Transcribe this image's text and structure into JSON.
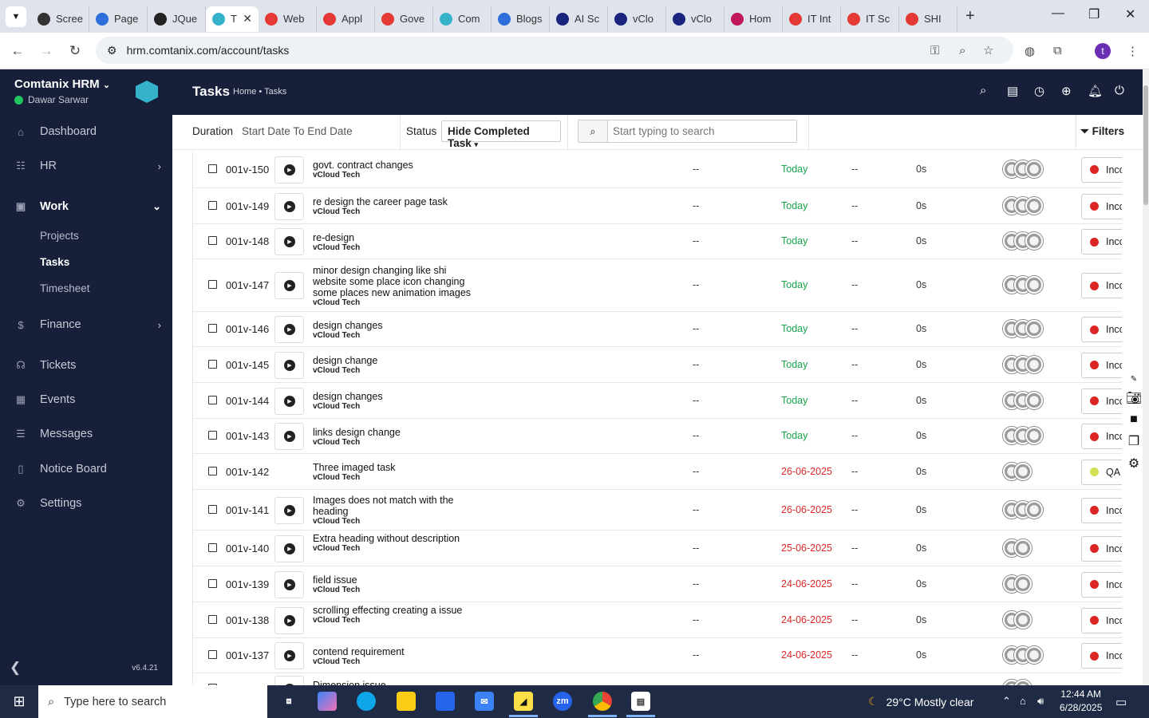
{
  "browser": {
    "tabs": [
      {
        "label": "Scree",
        "color": "#333"
      },
      {
        "label": "Page",
        "color": "#2a6fdb"
      },
      {
        "label": "JQue",
        "color": "#222"
      },
      {
        "label": "T",
        "color": "#35b2c9",
        "active": true
      },
      {
        "label": "Web",
        "color": "#e53935"
      },
      {
        "label": "Appl",
        "color": "#e53935"
      },
      {
        "label": "Gove",
        "color": "#e53935"
      },
      {
        "label": "Com",
        "color": "#35b2c9"
      },
      {
        "label": "Blogs",
        "color": "#2a6fdb"
      },
      {
        "label": "AI Sc",
        "color": "#1a237e"
      },
      {
        "label": "vClo",
        "color": "#1a237e"
      },
      {
        "label": "vClo",
        "color": "#1a237e"
      },
      {
        "label": "Hom",
        "color": "#c2185b"
      },
      {
        "label": "IT Int",
        "color": "#e53935"
      },
      {
        "label": "IT Sc",
        "color": "#e53935"
      },
      {
        "label": "SHI",
        "color": "#e53935"
      }
    ],
    "url": "hrm.comtanix.com/account/tasks",
    "profile_initial": "t"
  },
  "sidebar": {
    "brand": "Comtanix HRM",
    "user": "Dawar Sarwar",
    "menu": [
      {
        "label": "Dashboard",
        "icon": "home-icon"
      },
      {
        "label": "HR",
        "icon": "users-icon"
      },
      {
        "label": "Work",
        "icon": "briefcase-icon"
      },
      {
        "label": "Finance",
        "icon": "dollar-icon"
      },
      {
        "label": "Tickets",
        "icon": "headset-icon"
      },
      {
        "label": "Events",
        "icon": "calendar-icon"
      },
      {
        "label": "Messages",
        "icon": "message-icon"
      },
      {
        "label": "Notice Board",
        "icon": "clipboard-icon"
      },
      {
        "label": "Settings",
        "icon": "gear-icon"
      }
    ],
    "work_sub": [
      "Projects",
      "Tasks",
      "Timesheet"
    ],
    "version": "v6.4.21"
  },
  "header": {
    "title": "Tasks",
    "breadcrumb": "Home • Tasks"
  },
  "filters": {
    "duration_label": "Duration",
    "duration_value": "Start Date To End Date",
    "status_label": "Status",
    "status_value": "Hide Completed Task",
    "search_placeholder": "Start typing to search",
    "filters_label": "Filters"
  },
  "tasks": [
    {
      "code": "001v-150",
      "title": "govt. contract changes",
      "project": "vCloud Tech",
      "col1": "--",
      "due": "Today",
      "col3": "--",
      "time": "0s",
      "avatars": 3,
      "status": "Incomplete",
      "status_color": "#dc2626",
      "timer": true
    },
    {
      "code": "001v-149",
      "title": "re design the career page task",
      "project": "vCloud Tech",
      "col1": "--",
      "due": "Today",
      "col3": "--",
      "time": "0s",
      "avatars": 3,
      "status": "Incomplete",
      "status_color": "#dc2626",
      "timer": true
    },
    {
      "code": "001v-148",
      "title": "re-design",
      "project": "vCloud Tech",
      "col1": "--",
      "due": "Today",
      "col3": "--",
      "time": "0s",
      "avatars": 3,
      "status": "Incomplete",
      "status_color": "#dc2626",
      "timer": true
    },
    {
      "code": "001v-147",
      "title": "minor design changing like shi website some place icon changing some places new animation images",
      "project": "vCloud Tech",
      "col1": "--",
      "due": "Today",
      "col3": "--",
      "time": "0s",
      "avatars": 3,
      "status": "Incomplete",
      "status_color": "#dc2626",
      "timer": true
    },
    {
      "code": "001v-146",
      "title": "design changes",
      "project": "vCloud Tech",
      "col1": "--",
      "due": "Today",
      "col3": "--",
      "time": "0s",
      "avatars": 3,
      "status": "Incomplete",
      "status_color": "#dc2626",
      "timer": true
    },
    {
      "code": "001v-145",
      "title": "design change",
      "project": "vCloud Tech",
      "col1": "--",
      "due": "Today",
      "col3": "--",
      "time": "0s",
      "avatars": 3,
      "status": "Incomplete",
      "status_color": "#dc2626",
      "timer": true
    },
    {
      "code": "001v-144",
      "title": "design changes",
      "project": "vCloud Tech",
      "col1": "--",
      "due": "Today",
      "col3": "--",
      "time": "0s",
      "avatars": 3,
      "status": "Incomplete",
      "status_color": "#dc2626",
      "timer": true
    },
    {
      "code": "001v-143",
      "title": "links design change",
      "project": "vCloud Tech",
      "col1": "--",
      "due": "Today",
      "col3": "--",
      "time": "0s",
      "avatars": 3,
      "status": "Incomplete",
      "status_color": "#dc2626",
      "timer": true
    },
    {
      "code": "001v-142",
      "title": "Three imaged task",
      "project": "vCloud Tech",
      "col1": "--",
      "due": "26-06-2025",
      "col3": "--",
      "time": "0s",
      "avatars": 2,
      "status": "QA",
      "status_color": "#d4e157",
      "timer": false
    },
    {
      "code": "001v-141",
      "title": "Images does not match with the heading",
      "project": "vCloud Tech",
      "col1": "--",
      "due": "26-06-2025",
      "col3": "--",
      "time": "0s",
      "avatars": 3,
      "status": "Incomplete",
      "status_color": "#dc2626",
      "timer": true
    },
    {
      "code": "001v-140",
      "title": "Extra heading without description",
      "project": "vCloud Tech",
      "col1": "--",
      "due": "25-06-2025",
      "col3": "--",
      "time": "0s",
      "avatars": 2,
      "status": "Incomplete",
      "status_color": "#dc2626",
      "timer": true
    },
    {
      "code": "001v-139",
      "title": "field issue",
      "project": "vCloud Tech",
      "col1": "--",
      "due": "24-06-2025",
      "col3": "--",
      "time": "0s",
      "avatars": 2,
      "status": "Incomplete",
      "status_color": "#dc2626",
      "timer": true
    },
    {
      "code": "001v-138",
      "title": "scrolling effecting creating a issue",
      "project": "vCloud Tech",
      "col1": "--",
      "due": "24-06-2025",
      "col3": "--",
      "time": "0s",
      "avatars": 2,
      "status": "Incomplete",
      "status_color": "#dc2626",
      "timer": true
    },
    {
      "code": "001v-137",
      "title": "contend requirement",
      "project": "vCloud Tech",
      "col1": "--",
      "due": "24-06-2025",
      "col3": "--",
      "time": "0s",
      "avatars": 3,
      "status": "Incomplete",
      "status_color": "#dc2626",
      "timer": true
    },
    {
      "code": "",
      "title": "Dimension issue",
      "project": "",
      "col1": "",
      "due": "",
      "col3": "",
      "time": "",
      "avatars": 2,
      "status": "",
      "status_color": "#dc2626",
      "timer": true
    }
  ],
  "taskbar": {
    "search_placeholder": "Type here to search",
    "weather": "29°C  Mostly clear",
    "time": "12:44 AM",
    "date": "6/28/2025"
  }
}
